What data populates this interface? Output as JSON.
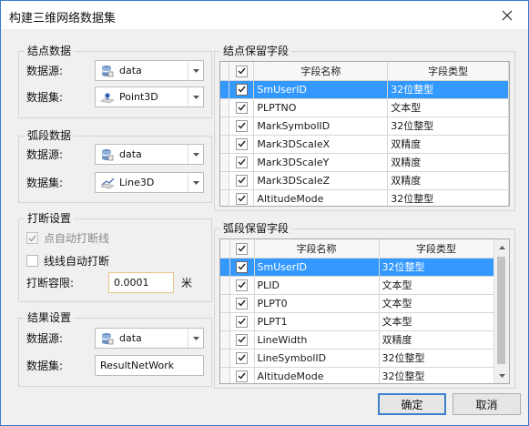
{
  "window": {
    "title": "构建三维网络数据集"
  },
  "node_data": {
    "title": "结点数据",
    "datasource_label": "数据源:",
    "datasource_value": "data",
    "dataset_label": "数据集:",
    "dataset_value": "Point3D"
  },
  "arc_data": {
    "title": "弧段数据",
    "datasource_label": "数据源:",
    "datasource_value": "data",
    "dataset_label": "数据集:",
    "dataset_value": "Line3D"
  },
  "break_settings": {
    "title": "打断设置",
    "auto_break_point_label": "点自动打断线",
    "auto_break_point_checked": true,
    "auto_break_line_label": "线线自动打断",
    "auto_break_line_checked": false,
    "tolerance_label": "打断容限:",
    "tolerance_value": "0.0001",
    "tolerance_unit": "米"
  },
  "result_settings": {
    "title": "结果设置",
    "datasource_label": "数据源:",
    "datasource_value": "data",
    "dataset_label": "数据集:",
    "dataset_value": "ResultNetWork"
  },
  "node_fields": {
    "title": "结点保留字段",
    "col_name": "字段名称",
    "col_type": "字段类型",
    "header_checked": true,
    "rows": [
      {
        "name": "SmUserID",
        "type": "32位整型",
        "checked": true,
        "selected": true
      },
      {
        "name": "PLPTNO",
        "type": "文本型",
        "checked": true,
        "selected": false
      },
      {
        "name": "MarkSymbolID",
        "type": "32位整型",
        "checked": true,
        "selected": false
      },
      {
        "name": "Mark3DScaleX",
        "type": "双精度",
        "checked": true,
        "selected": false
      },
      {
        "name": "Mark3DScaleY",
        "type": "双精度",
        "checked": true,
        "selected": false
      },
      {
        "name": "Mark3DScaleZ",
        "type": "双精度",
        "checked": true,
        "selected": false
      },
      {
        "name": "AltitudeMode",
        "type": "32位整型",
        "checked": true,
        "selected": false
      }
    ]
  },
  "arc_fields": {
    "title": "弧段保留字段",
    "col_name": "字段名称",
    "col_type": "字段类型",
    "header_checked": true,
    "rows": [
      {
        "name": "SmUserID",
        "type": "32位整型",
        "checked": true,
        "selected": true
      },
      {
        "name": "PLID",
        "type": "文本型",
        "checked": true,
        "selected": false
      },
      {
        "name": "PLPT0",
        "type": "文本型",
        "checked": true,
        "selected": false
      },
      {
        "name": "PLPT1",
        "type": "文本型",
        "checked": true,
        "selected": false
      },
      {
        "name": "LineWidth",
        "type": "双精度",
        "checked": true,
        "selected": false
      },
      {
        "name": "LineSymbolID",
        "type": "32位整型",
        "checked": true,
        "selected": false
      },
      {
        "name": "AltitudeMode",
        "type": "32位整型",
        "checked": true,
        "selected": false
      }
    ]
  },
  "buttons": {
    "ok": "确定",
    "cancel": "取消"
  },
  "icons": {
    "datasource": "database-icon",
    "point_dataset": "point-dataset-icon",
    "line_dataset": "line-dataset-icon",
    "close": "close-icon",
    "dropdown": "chevron-down-icon"
  },
  "colors": {
    "selection": "#3399ff",
    "window_border": "#3c78c8",
    "default_button_border": "#3c7fd1"
  }
}
